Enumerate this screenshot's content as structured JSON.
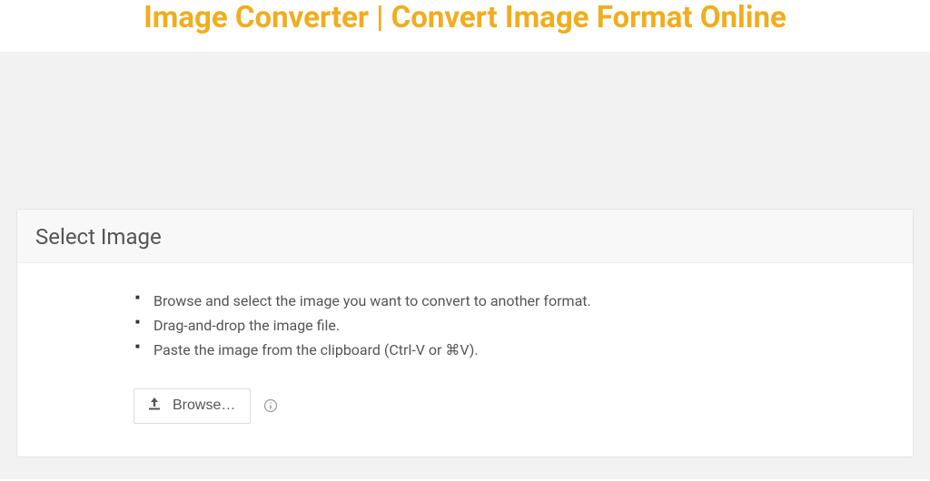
{
  "header": {
    "title": "Image Converter | Convert Image Format Online"
  },
  "panel": {
    "title": "Select Image",
    "instructions": [
      "Browse and select the image you want to convert to another format.",
      "Drag-and-drop the image file.",
      "Paste the image from the clipboard (Ctrl-V or ⌘V)."
    ],
    "browse_label": "Browse…"
  }
}
